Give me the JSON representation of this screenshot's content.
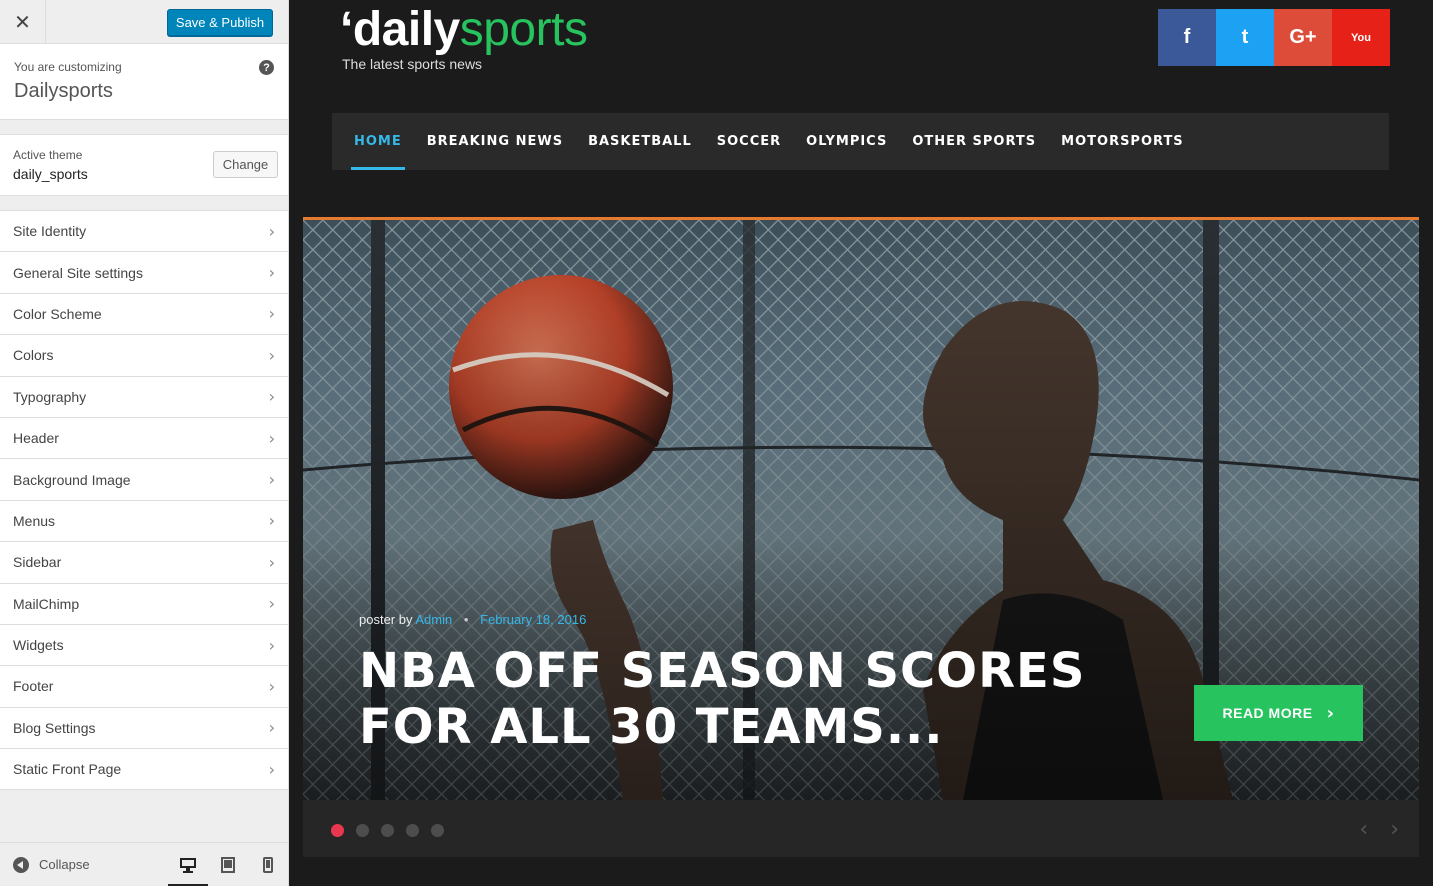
{
  "customizer": {
    "close_icon": "close-icon",
    "save_label": "Save & Publish",
    "customizing_label": "You are customizing",
    "site_name": "Dailysports",
    "help_label": "?",
    "active_theme_label": "Active theme",
    "theme_name": "daily_sports",
    "change_label": "Change",
    "sections": [
      {
        "label": "Site Identity"
      },
      {
        "label": "General Site settings"
      },
      {
        "label": "Color Scheme"
      },
      {
        "label": "Colors"
      },
      {
        "label": "Typography"
      },
      {
        "label": "Header"
      },
      {
        "label": "Background Image"
      },
      {
        "label": "Menus"
      },
      {
        "label": "Sidebar"
      },
      {
        "label": "MailChimp"
      },
      {
        "label": "Widgets"
      },
      {
        "label": "Footer"
      },
      {
        "label": "Blog Settings"
      },
      {
        "label": "Static Front Page"
      }
    ],
    "collapse_label": "Collapse",
    "devices": [
      "desktop-icon",
      "tablet-icon",
      "mobile-icon"
    ]
  },
  "site": {
    "logo_quote": "‘",
    "logo_part1": "daily",
    "logo_part2": "sports",
    "tagline": "The latest sports news",
    "social": [
      {
        "icon": "facebook-icon",
        "glyph": "f",
        "color": "#3b5998"
      },
      {
        "icon": "twitter-icon",
        "glyph": "t",
        "color": "#1da1f2"
      },
      {
        "icon": "google-plus-icon",
        "glyph": "G+",
        "color": "#dd4b39"
      },
      {
        "icon": "youtube-icon",
        "glyph": "You",
        "color": "#e62117"
      }
    ],
    "nav": [
      "HOME",
      "BREAKING NEWS",
      "BASKETBALL",
      "SOCCER",
      "OLYMPICS",
      "OTHER SPORTS",
      "MOTORSPORTS"
    ]
  },
  "slider": {
    "poster_prefix": "poster by",
    "author": "Admin",
    "separator": "•",
    "date": "February 18, 2016",
    "headline": "NBA OFF SEASON SCORES FOR ALL 30 TEAMS...",
    "read_more": "READ MORE",
    "slide_count": 5,
    "active_slide": 1,
    "prev_arrow": "‹",
    "next_arrow": "›"
  },
  "colors": {
    "accent_blue": "#35b8e8",
    "accent_green": "#27c35f",
    "accent_orange": "#e67a2e",
    "dot_active": "#e8384f",
    "wp_blue": "#0085ba"
  }
}
